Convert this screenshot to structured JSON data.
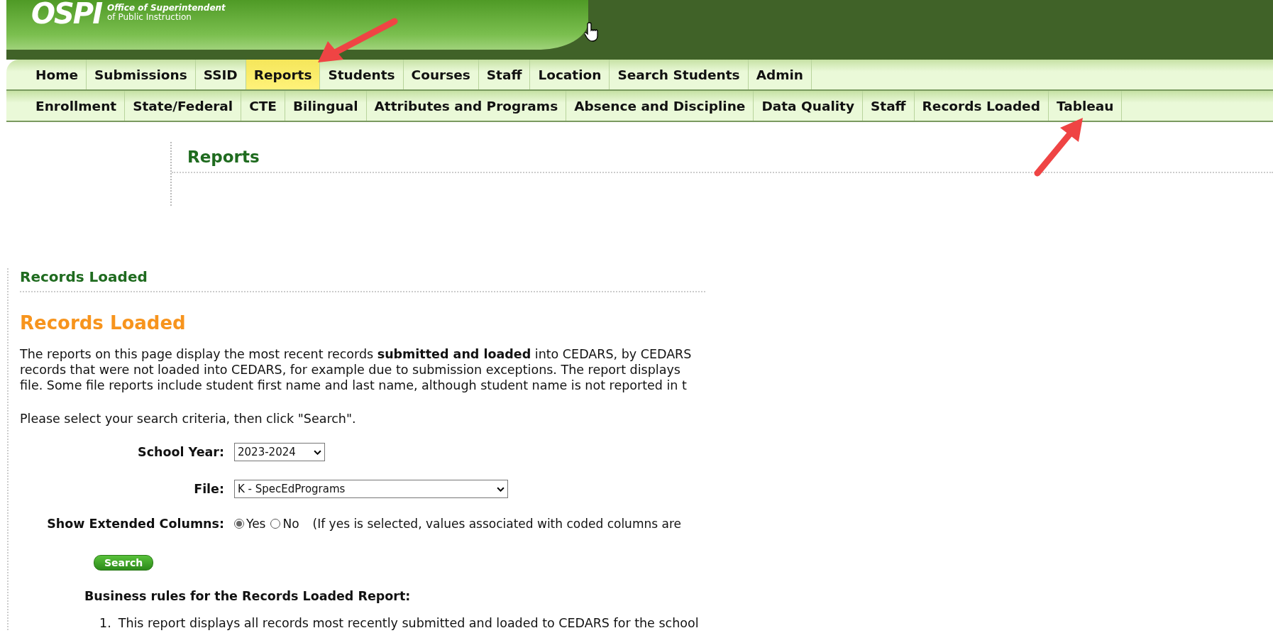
{
  "header": {
    "logo": "OSPI",
    "org_line_1": "Office of Superintendent",
    "org_line_2": "of Public Instruction"
  },
  "main_nav": [
    {
      "label": "Home",
      "selected": false
    },
    {
      "label": "Submissions",
      "selected": false
    },
    {
      "label": "SSID",
      "selected": false
    },
    {
      "label": "Reports",
      "selected": true
    },
    {
      "label": "Students",
      "selected": false
    },
    {
      "label": "Courses",
      "selected": false
    },
    {
      "label": "Staff",
      "selected": false
    },
    {
      "label": "Location",
      "selected": false
    },
    {
      "label": "Search Students",
      "selected": false
    },
    {
      "label": "Admin",
      "selected": false
    }
  ],
  "sub_nav": [
    {
      "label": "Enrollment",
      "selected": false
    },
    {
      "label": "State/Federal",
      "selected": false
    },
    {
      "label": "CTE",
      "selected": false
    },
    {
      "label": "Bilingual",
      "selected": false
    },
    {
      "label": "Attributes and Programs",
      "selected": false
    },
    {
      "label": "Absence and Discipline",
      "selected": false
    },
    {
      "label": "Data Quality",
      "selected": false
    },
    {
      "label": "Staff",
      "selected": false
    },
    {
      "label": "Records Loaded",
      "selected": false
    },
    {
      "label": "Tableau",
      "selected": false
    }
  ],
  "page_title": "Reports",
  "section_title": "Records Loaded",
  "report_title": "Records Loaded",
  "intro_lines": [
    "The reports on this page display the most recent records **submitted and loaded** into CEDARS, by CEDARS",
    "records that were not loaded into CEDARS, for example due to submission exceptions. The report displays",
    "file. Some file reports include student first name and last name, although student name is not reported in t"
  ],
  "instruction": "Please select your search criteria, then click \"Search\".",
  "form": {
    "school_year": {
      "label": "School Year:",
      "value": "2023-2024"
    },
    "file": {
      "label": "File:",
      "value": "K - SpecEdPrograms"
    },
    "extended_columns": {
      "label": "Show Extended Columns:",
      "options": [
        {
          "label": "Yes",
          "selected": true
        },
        {
          "label": "No",
          "selected": false
        }
      ],
      "note": "(If yes is selected, values associated with coded columns are"
    }
  },
  "search_button": "Search",
  "rules_title": "Business rules for the Records Loaded Report:",
  "rules": [
    {
      "number": "1.",
      "text": "This report displays all records most recently submitted and loaded to CEDARS for the school"
    }
  ]
}
